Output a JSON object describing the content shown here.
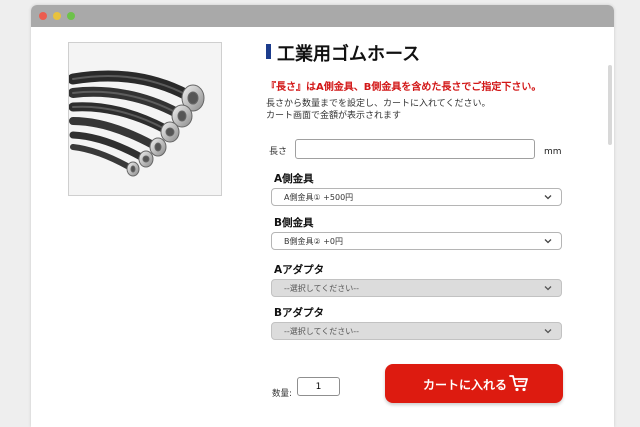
{
  "product": {
    "title": "工業用ゴムホース",
    "notice": "『長さ』はA側金具、B側金具を含めた長さでご指定下さい。",
    "instructions": [
      "長さから数量までを設定し、カートに入れてください。",
      "カート画面で金額が表示されます"
    ],
    "image_icon": "rubber-hose-image"
  },
  "length": {
    "label": "長さ",
    "value": "",
    "unit": "mm"
  },
  "options": [
    {
      "label": "A側金具",
      "selected": "A側金具① +500円",
      "disabled": false
    },
    {
      "label": "B側金具",
      "selected": "B側金具② +0円",
      "disabled": false
    },
    {
      "label": "Aアダプタ",
      "selected": "--選択してください--",
      "disabled": true
    },
    {
      "label": "Bアダプタ",
      "selected": "--選択してください--",
      "disabled": true
    }
  ],
  "quantity": {
    "label": "数量:",
    "value": "1"
  },
  "cart_button": {
    "label": "カートに入れる",
    "icon": "cart-icon"
  },
  "colors": {
    "accent": "#1c3c8c",
    "notice": "#d21717",
    "button": "#dd1b10"
  }
}
